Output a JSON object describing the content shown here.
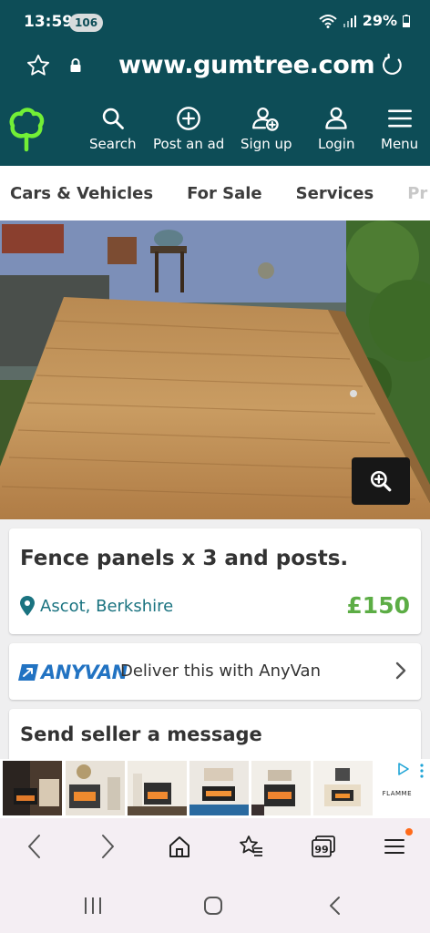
{
  "status_bar": {
    "time": "13:59",
    "notification_count": "106",
    "battery": "29%"
  },
  "browser": {
    "url": "www.gumtree.com"
  },
  "site_nav": {
    "items": [
      {
        "label": "Search",
        "icon": "search-icon"
      },
      {
        "label": "Post an ad",
        "icon": "plus-circle-icon"
      },
      {
        "label": "Sign up",
        "icon": "user-plus-icon"
      },
      {
        "label": "Login",
        "icon": "user-icon"
      },
      {
        "label": "Menu",
        "icon": "hamburger-icon"
      }
    ]
  },
  "categories": [
    "Cars & Vehicles",
    "For Sale",
    "Services",
    "Pr"
  ],
  "listing": {
    "title": "Fence panels x 3 and posts.",
    "location": "Ascot, Berkshire",
    "price": "£150"
  },
  "delivery": {
    "brand": "ANYVAN",
    "text": "Deliver this with AnyVan"
  },
  "message_section": {
    "title": "Send seller a message"
  },
  "ad": {
    "brand": "FLAMME"
  },
  "colors": {
    "brand_teal": "#0d4d57",
    "price_green": "#5cad45",
    "location_teal": "#1a7380",
    "logo_green": "#72ef36",
    "anyvan_blue": "#2273c2"
  }
}
